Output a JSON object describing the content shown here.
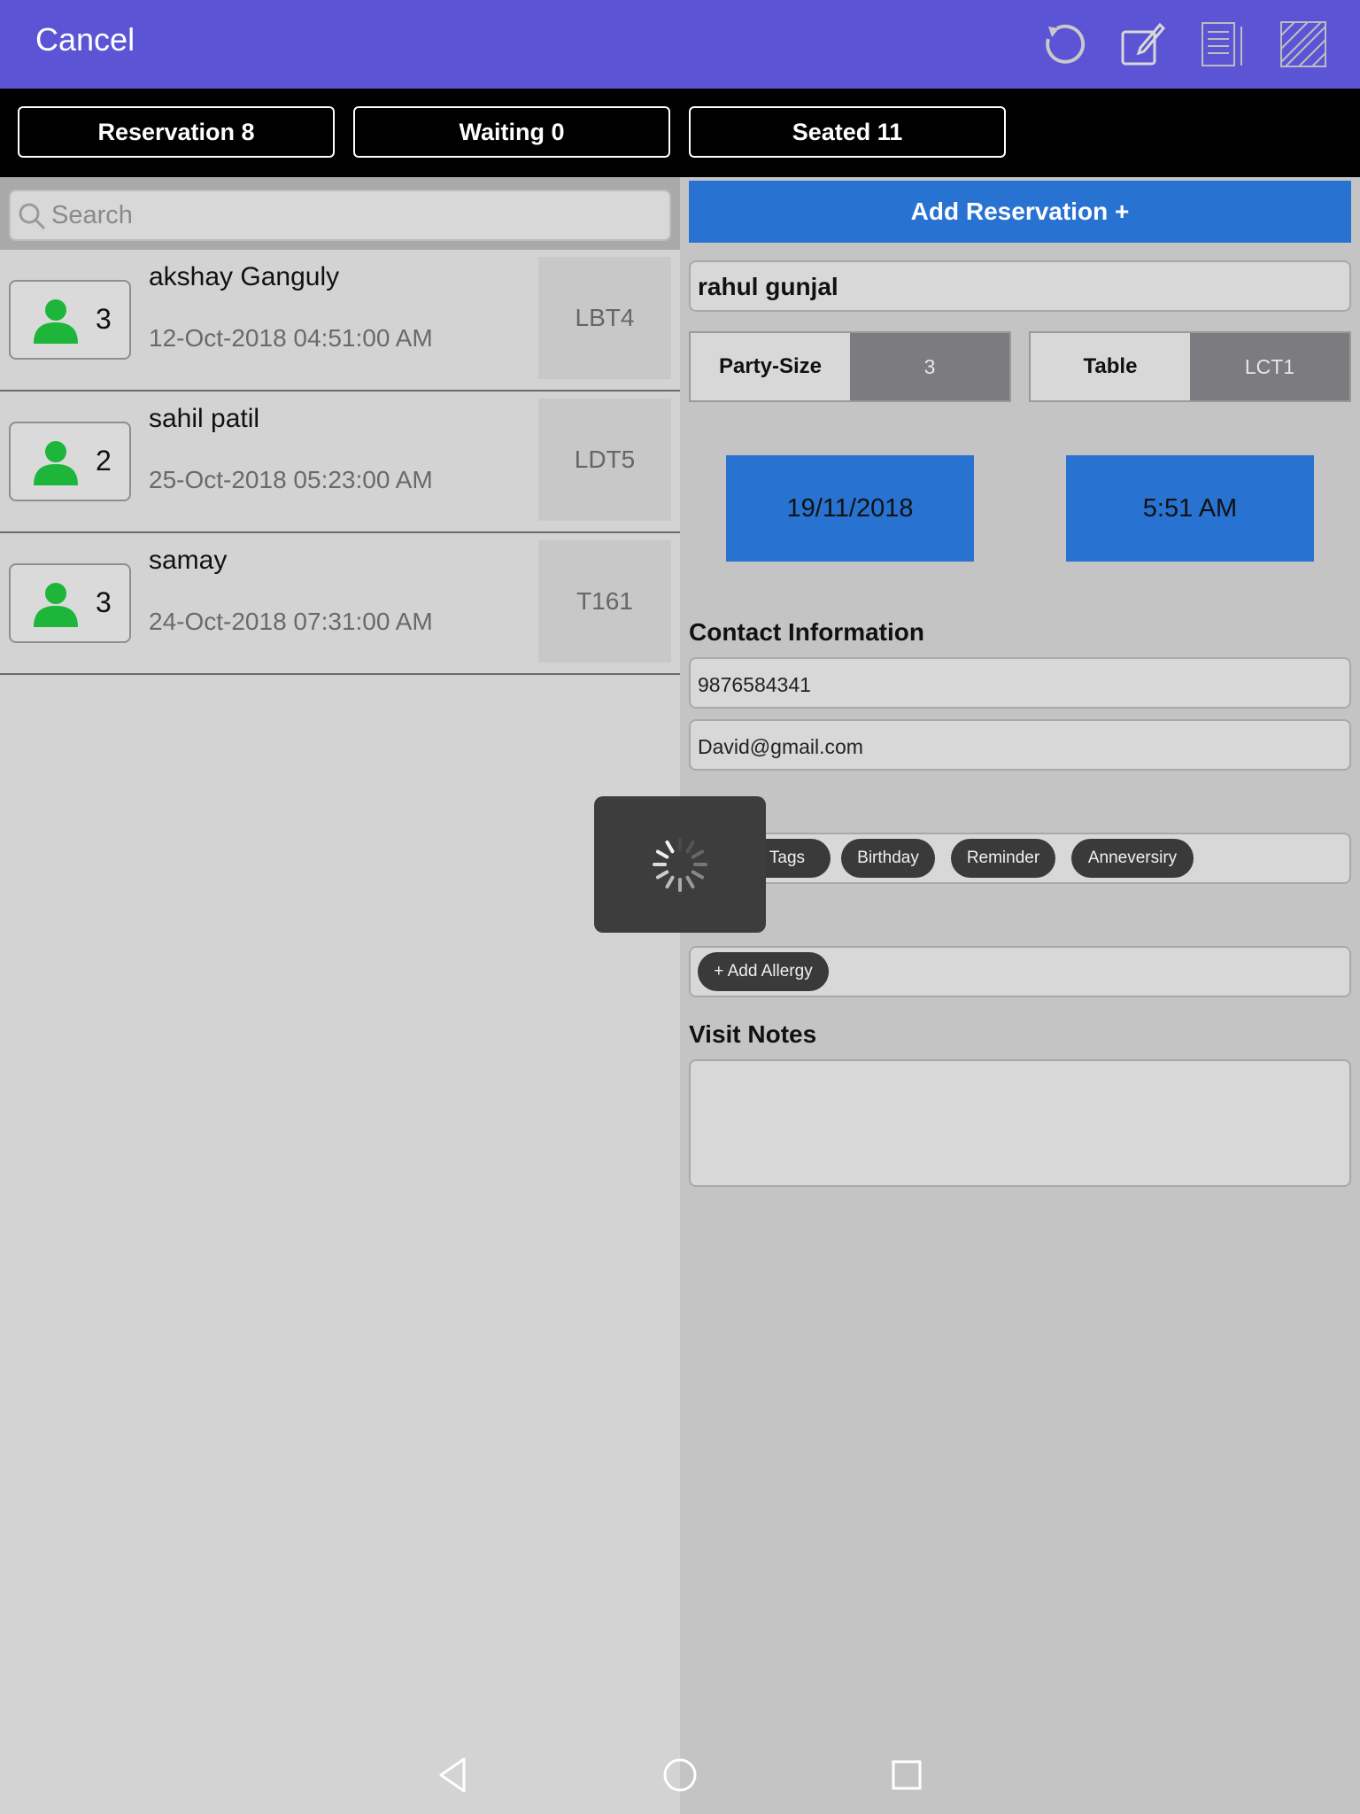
{
  "header": {
    "cancel_label": "Cancel",
    "icons": [
      "refresh-icon",
      "edit-icon",
      "notes-icon",
      "floor-plan-icon"
    ],
    "bg_color": "#5b55d6"
  },
  "tabs": [
    {
      "label": "Reservation 8"
    },
    {
      "label": "Waiting 0"
    },
    {
      "label": "Seated 11"
    }
  ],
  "search": {
    "placeholder": "Search"
  },
  "reservations": [
    {
      "count": "3",
      "name": "akshay Ganguly",
      "datetime": "12-Oct-2018 04:51:00 AM",
      "table": "LBT4"
    },
    {
      "count": "2",
      "name": "sahil patil",
      "datetime": "25-Oct-2018 05:23:00 AM",
      "table": "LDT5"
    },
    {
      "count": "3",
      "name": "samay",
      "datetime": "24-Oct-2018 07:31:00 AM",
      "table": "T161"
    }
  ],
  "form": {
    "add_label": "Add Reservation +",
    "guest_name": "rahul gunjal",
    "party_size_label": "Party-Size",
    "party_size_value": "3",
    "table_label": "Table",
    "table_value": "LCT1",
    "date": "19/11/2018",
    "time": "5:51 AM",
    "contact_title": "Contact Information",
    "phone": "9876584341",
    "email": "David@gmail.com",
    "tags": [
      "Tags",
      "Birthday",
      "Reminder",
      "Anneversiry"
    ],
    "allergy_button": "+ Add Allergy",
    "notes_title": "Visit Notes",
    "notes_value": ""
  },
  "colors": {
    "accent_blue": "#2872d1",
    "person_icon_green": "#1db53a",
    "value_gray": "#7b7b80"
  },
  "loading": {
    "visible": true,
    "icon": "spinner-icon"
  },
  "navbar": {
    "icons": [
      "back-icon",
      "home-icon",
      "recents-icon"
    ]
  }
}
